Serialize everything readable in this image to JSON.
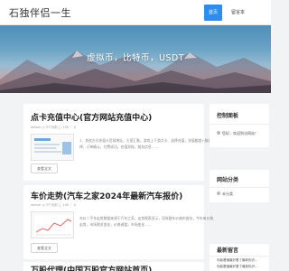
{
  "header": {
    "logo": "石独伴侣一生",
    "nav": [
      "首页",
      "留言本"
    ]
  },
  "banner": {
    "text": "虚拟币，比特币，USDT"
  },
  "posts": [
    {
      "title": "点卡充值中心(官方网站充值中心)",
      "meta": "admin  ◷ 3个月前  ▢ 100  ♡ 0",
      "excerpt": "1、其他方式充值卡官网地址，大家汇聚，游戏上下游点卡、选择充值，充值额度+服务选择，订单确认，付费成功，充值到账，服务信息……",
      "button": "查看全文"
    },
    {
      "title": "车价走势(汽车之家2024年最新汽车报价)",
      "meta": "admin  ◷ 3个月前  ▢ 100  ♡ 0",
      "excerpt": "车价二手车走势数据来源于汽车之家，走势图表显示，导致整车价格的变化，今年来价格走势，市场需求变化，价格调整，市场变化……",
      "button": "查看全文"
    },
    {
      "title": "万股代理(中国万股官方网站首页)",
      "meta": "",
      "excerpt": "",
      "button": ""
    }
  ],
  "sidebar": {
    "control_panel": {
      "title": "控制面板",
      "text": "您好，欢迎到访网站！"
    },
    "categories": {
      "title": "网站分类",
      "items": [
        "未分类"
      ]
    },
    "recent_comments": {
      "title": "最新留言",
      "items": [
        "你能看懂最好看了最新知识…",
        "你能看懂最好看了最新知识…",
        "你能看懂最好看了最新知识…",
        "你能看懂最好看了最新知识…"
      ]
    }
  },
  "colors": {
    "accent": "#2d8cf0",
    "page_bg": "#f1f3f4"
  }
}
